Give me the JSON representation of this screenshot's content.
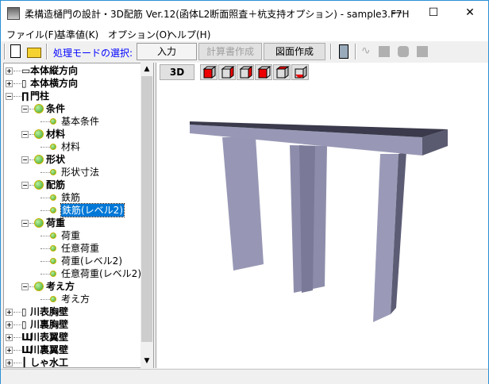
{
  "window": {
    "title": "柔構造樋門の設計・3D配筋 Ver.12(函体L2断面照査＋杭支持オプション) - sample3.F7H",
    "minimize": "—",
    "maximize": "☐",
    "close": "✕"
  },
  "menu": [
    "ファイル(F)",
    "基準値(K)",
    "オプション(O)",
    "ヘルプ(H)"
  ],
  "toolbar": {
    "mode_label": "処理モードの選択:",
    "input": "入力",
    "calc_report": "計算書作成",
    "drawing": "図面作成",
    "mode_label_color": "#0000ff"
  },
  "view": {
    "btn_3d": "3D"
  },
  "tree": [
    {
      "label": "本体縦方向",
      "level": 0,
      "bold": true,
      "exp": "+",
      "icon": "box"
    },
    {
      "label": "本体横方向",
      "level": 0,
      "bold": true,
      "exp": "+",
      "icon": "frame"
    },
    {
      "label": "門柱",
      "level": 0,
      "bold": true,
      "exp": "-",
      "icon": "gate"
    },
    {
      "label": "条件",
      "level": 1,
      "bold": true,
      "exp": "-"
    },
    {
      "label": "基本条件",
      "level": 2
    },
    {
      "label": "材料",
      "level": 1,
      "bold": true,
      "exp": "-"
    },
    {
      "label": "材料",
      "level": 2
    },
    {
      "label": "形状",
      "level": 1,
      "bold": true,
      "exp": "-"
    },
    {
      "label": "形状寸法",
      "level": 2
    },
    {
      "label": "配筋",
      "level": 1,
      "bold": true,
      "exp": "-"
    },
    {
      "label": "鉄筋",
      "level": 2
    },
    {
      "label": "鉄筋(レベル2)",
      "level": 2,
      "selected": true
    },
    {
      "label": "荷重",
      "level": 1,
      "bold": true,
      "exp": "-"
    },
    {
      "label": "荷重",
      "level": 2
    },
    {
      "label": "任意荷重",
      "level": 2
    },
    {
      "label": "荷重(レベル2)",
      "level": 2
    },
    {
      "label": "任意荷重(レベル2)",
      "level": 2
    },
    {
      "label": "考え方",
      "level": 1,
      "bold": true,
      "exp": "-"
    },
    {
      "label": "考え方",
      "level": 2
    },
    {
      "label": "川表胸壁",
      "level": 0,
      "bold": true,
      "exp": "+",
      "icon": "frame"
    },
    {
      "label": "川裏胸壁",
      "level": 0,
      "bold": true,
      "exp": "+",
      "icon": "frame"
    },
    {
      "label": "川表翼壁",
      "level": 0,
      "bold": true,
      "exp": "+",
      "icon": "wing"
    },
    {
      "label": "川裏翼壁",
      "level": 0,
      "bold": true,
      "exp": "+",
      "icon": "wing"
    },
    {
      "label": "しゃ水工",
      "level": 0,
      "bold": true,
      "exp": "+",
      "icon": "bar"
    }
  ]
}
